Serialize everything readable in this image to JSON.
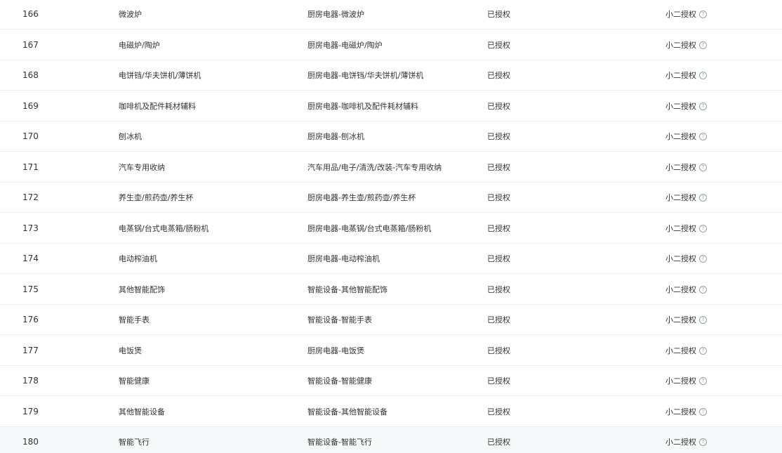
{
  "table": {
    "help_icon_glyph": "?",
    "help_icon_color": "#9aa0a6",
    "hover_row_color": "#f7f8fa",
    "rows": [
      {
        "id": "166",
        "name": "微波炉",
        "path": "厨房电器-微波炉",
        "status": "已授权",
        "auth": "小二授权"
      },
      {
        "id": "167",
        "name": "电磁炉/陶炉",
        "path": "厨房电器-电磁炉/陶炉",
        "status": "已授权",
        "auth": "小二授权"
      },
      {
        "id": "168",
        "name": "电饼铛/华夫饼机/薄饼机",
        "path": "厨房电器-电饼铛/华夫饼机/薄饼机",
        "status": "已授权",
        "auth": "小二授权"
      },
      {
        "id": "169",
        "name": "咖啡机及配件耗材辅料",
        "path": "厨房电器-咖啡机及配件耗材辅料",
        "status": "已授权",
        "auth": "小二授权"
      },
      {
        "id": "170",
        "name": "刨冰机",
        "path": "厨房电器-刨冰机",
        "status": "已授权",
        "auth": "小二授权"
      },
      {
        "id": "171",
        "name": "汽车专用收纳",
        "path": "汽车用品/电子/清洗/改装-汽车专用收纳",
        "status": "已授权",
        "auth": "小二授权"
      },
      {
        "id": "172",
        "name": "养生壶/煎药壶/养生杯",
        "path": "厨房电器-养生壶/煎药壶/养生杯",
        "status": "已授权",
        "auth": "小二授权"
      },
      {
        "id": "173",
        "name": "电蒸锅/台式电蒸箱/肠粉机",
        "path": "厨房电器-电蒸锅/台式电蒸箱/肠粉机",
        "status": "已授权",
        "auth": "小二授权"
      },
      {
        "id": "174",
        "name": "电动榨油机",
        "path": "厨房电器-电动榨油机",
        "status": "已授权",
        "auth": "小二授权"
      },
      {
        "id": "175",
        "name": "其他智能配饰",
        "path": "智能设备-其他智能配饰",
        "status": "已授权",
        "auth": "小二授权"
      },
      {
        "id": "176",
        "name": "智能手表",
        "path": "智能设备-智能手表",
        "status": "已授权",
        "auth": "小二授权"
      },
      {
        "id": "177",
        "name": "电饭煲",
        "path": "厨房电器-电饭煲",
        "status": "已授权",
        "auth": "小二授权"
      },
      {
        "id": "178",
        "name": "智能健康",
        "path": "智能设备-智能健康",
        "status": "已授权",
        "auth": "小二授权"
      },
      {
        "id": "179",
        "name": "其他智能设备",
        "path": "智能设备-其他智能设备",
        "status": "已授权",
        "auth": "小二授权"
      },
      {
        "id": "180",
        "name": "智能飞行",
        "path": "智能设备-智能飞行",
        "status": "已授权",
        "auth": "小二授权"
      }
    ]
  }
}
